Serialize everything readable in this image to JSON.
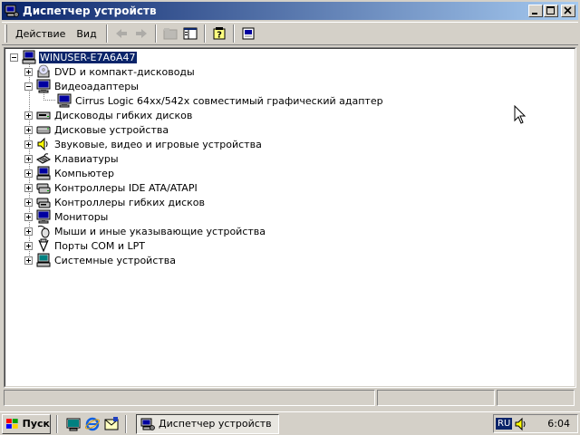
{
  "window": {
    "title": "Диспетчер устройств",
    "controls": {
      "minimize": "_",
      "maximize": "□",
      "close": "×"
    }
  },
  "menu": {
    "action": "Действие",
    "view": "Вид"
  },
  "toolbar": {
    "buttons": [
      "back-icon",
      "forward-icon",
      "folder-up-icon",
      "show-hide-tree-icon",
      "help-icon",
      "properties-icon"
    ]
  },
  "tree": {
    "root": "WINUSER-E7A6A47",
    "nodes": [
      {
        "label": "DVD и компакт-дисководы",
        "icon": "cdrom-icon",
        "expanded": false
      },
      {
        "label": "Видеоадаптеры",
        "icon": "display-adapter-icon",
        "expanded": true,
        "children": [
          {
            "label": "Cirrus Logic 64xx/542x совместимый графический адаптер",
            "icon": "display-adapter-icon"
          }
        ]
      },
      {
        "label": "Дисководы гибких дисков",
        "icon": "floppy-drive-icon",
        "expanded": false
      },
      {
        "label": "Дисковые устройства",
        "icon": "disk-drive-icon",
        "expanded": false
      },
      {
        "label": "Звуковые, видео и игровые устройства",
        "icon": "sound-icon",
        "expanded": false
      },
      {
        "label": "Клавиатуры",
        "icon": "keyboard-icon",
        "expanded": false
      },
      {
        "label": "Компьютер",
        "icon": "computer-icon",
        "expanded": false
      },
      {
        "label": "Контроллеры IDE ATA/ATAPI",
        "icon": "ide-controller-icon",
        "expanded": false
      },
      {
        "label": "Контроллеры гибких дисков",
        "icon": "floppy-controller-icon",
        "expanded": false
      },
      {
        "label": "Мониторы",
        "icon": "monitor-icon",
        "expanded": false
      },
      {
        "label": "Мыши и иные указывающие устройства",
        "icon": "mouse-icon",
        "expanded": false
      },
      {
        "label": "Порты COM и LPT",
        "icon": "port-icon",
        "expanded": false
      },
      {
        "label": "Системные устройства",
        "icon": "system-device-icon",
        "expanded": false
      }
    ]
  },
  "taskbar": {
    "start_label": "Пуск",
    "task_label": "Диспетчер устройств",
    "language": "RU",
    "clock": "6:04"
  },
  "colors": {
    "titlebar_start": "#0a246a",
    "titlebar_end": "#a6caf0",
    "face": "#d4d0c8",
    "selection": "#0a246a"
  }
}
